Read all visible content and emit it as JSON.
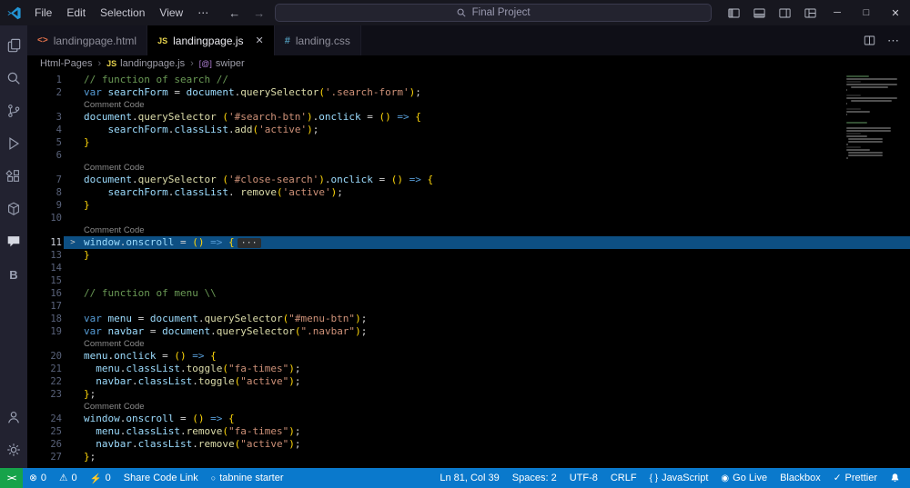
{
  "titlebar": {
    "menus": [
      "File",
      "Edit",
      "Selection",
      "View"
    ],
    "overflow": "⋯",
    "nav_back": "←",
    "nav_forward": "→",
    "search": {
      "value": "Final Project"
    },
    "window_icons": [
      "layout-sidebar-left-icon",
      "layout-panel-icon",
      "layout-sidebar-right-icon",
      "layout-customize-icon"
    ],
    "window_controls": {
      "minimize": "─",
      "maximize": "□",
      "close": "✕"
    }
  },
  "activity_bar": {
    "top": [
      "explorer-icon",
      "search-icon",
      "source-control-icon",
      "run-debug-icon",
      "extensions-icon",
      "package-icon",
      "comments-icon",
      "blackbox-b-icon"
    ],
    "bottom": [
      "account-icon",
      "settings-gear-icon"
    ]
  },
  "tabs": {
    "items": [
      {
        "icon": "html-icon",
        "label": "landingpage.html",
        "active": false
      },
      {
        "icon": "js-icon",
        "label": "landingpage.js",
        "active": true,
        "close": "✕"
      },
      {
        "icon": "css-icon",
        "label": "landing.css",
        "active": false
      }
    ],
    "actions": [
      "split-editor-icon",
      "more-actions-icon"
    ]
  },
  "breadcrumbs": {
    "separator": "›",
    "items": [
      {
        "label": "Html-Pages"
      },
      {
        "label": "landingpage.js",
        "icon": "js-icon"
      },
      {
        "label": "swiper",
        "icon": "symbol-icon"
      }
    ]
  },
  "editor": {
    "fold_marker": ">",
    "rows": [
      {
        "n": "1",
        "seg": [
          [
            "cm",
            "// function of search //"
          ]
        ]
      },
      {
        "n": "2",
        "seg": [
          [
            "kw",
            "var"
          ],
          [
            "pn",
            " "
          ],
          [
            "vr",
            "searchForm"
          ],
          [
            "pn",
            " "
          ],
          [
            "op",
            "="
          ],
          [
            "pn",
            " "
          ],
          [
            "vr",
            "document"
          ],
          [
            "pn",
            "."
          ],
          [
            "fn",
            "querySelector"
          ],
          [
            "br",
            "("
          ],
          [
            "st",
            "'.search-form'"
          ],
          [
            "br",
            ")"
          ],
          [
            "pn",
            ";"
          ]
        ]
      },
      {
        "lens": "Comment Code"
      },
      {
        "n": "3",
        "seg": [
          [
            "vr",
            "document"
          ],
          [
            "pn",
            "."
          ],
          [
            "fn",
            "querySelector"
          ],
          [
            "pn",
            " "
          ],
          [
            "br",
            "("
          ],
          [
            "st",
            "'#search-btn'"
          ],
          [
            "br",
            ")"
          ],
          [
            "pn",
            "."
          ],
          [
            "vr",
            "onclick"
          ],
          [
            "pn",
            " "
          ],
          [
            "op",
            "="
          ],
          [
            "pn",
            " "
          ],
          [
            "br",
            "()"
          ],
          [
            "pn",
            " "
          ],
          [
            "kw",
            "=>"
          ],
          [
            "pn",
            " "
          ],
          [
            "br",
            "{"
          ]
        ]
      },
      {
        "n": "4",
        "seg": [
          [
            "pn",
            "    "
          ],
          [
            "vr",
            "searchForm"
          ],
          [
            "pn",
            "."
          ],
          [
            "vr",
            "classList"
          ],
          [
            "pn",
            "."
          ],
          [
            "fn",
            "add"
          ],
          [
            "br",
            "("
          ],
          [
            "st",
            "'active'"
          ],
          [
            "br",
            ")"
          ],
          [
            "pn",
            ";"
          ]
        ]
      },
      {
        "n": "5",
        "seg": [
          [
            "br",
            "}"
          ]
        ]
      },
      {
        "n": "6",
        "seg": []
      },
      {
        "lens": "Comment Code"
      },
      {
        "n": "7",
        "seg": [
          [
            "vr",
            "document"
          ],
          [
            "pn",
            "."
          ],
          [
            "fn",
            "querySelector"
          ],
          [
            "pn",
            " "
          ],
          [
            "br",
            "("
          ],
          [
            "st",
            "'#close-search'"
          ],
          [
            "br",
            ")"
          ],
          [
            "pn",
            "."
          ],
          [
            "vr",
            "onclick"
          ],
          [
            "pn",
            " "
          ],
          [
            "op",
            "="
          ],
          [
            "pn",
            " "
          ],
          [
            "br",
            "()"
          ],
          [
            "pn",
            " "
          ],
          [
            "kw",
            "=>"
          ],
          [
            "pn",
            " "
          ],
          [
            "br",
            "{"
          ]
        ]
      },
      {
        "n": "8",
        "seg": [
          [
            "pn",
            "    "
          ],
          [
            "vr",
            "searchForm"
          ],
          [
            "pn",
            "."
          ],
          [
            "vr",
            "classList"
          ],
          [
            "pn",
            ". "
          ],
          [
            "fn",
            "remove"
          ],
          [
            "br",
            "("
          ],
          [
            "st",
            "'active'"
          ],
          [
            "br",
            ")"
          ],
          [
            "pn",
            ";"
          ]
        ]
      },
      {
        "n": "9",
        "seg": [
          [
            "br",
            "}"
          ]
        ]
      },
      {
        "n": "10",
        "seg": []
      },
      {
        "lens": "Comment Code"
      },
      {
        "n": "11",
        "hl": true,
        "fold": true,
        "ellipsis": "···",
        "seg": [
          [
            "vr",
            "window"
          ],
          [
            "pn",
            "."
          ],
          [
            "vr",
            "onscroll"
          ],
          [
            "pn",
            " "
          ],
          [
            "op",
            "="
          ],
          [
            "pn",
            " "
          ],
          [
            "br",
            "()"
          ],
          [
            "pn",
            " "
          ],
          [
            "kw",
            "=>"
          ],
          [
            "pn",
            " "
          ],
          [
            "br",
            "{"
          ]
        ]
      },
      {
        "n": "13",
        "seg": [
          [
            "br",
            "}"
          ]
        ]
      },
      {
        "n": "14",
        "seg": []
      },
      {
        "n": "15",
        "seg": []
      },
      {
        "n": "16",
        "seg": [
          [
            "cm",
            "// function of menu \\\\"
          ]
        ]
      },
      {
        "n": "17",
        "seg": []
      },
      {
        "n": "18",
        "seg": [
          [
            "kw",
            "var"
          ],
          [
            "pn",
            " "
          ],
          [
            "vr",
            "menu"
          ],
          [
            "pn",
            " "
          ],
          [
            "op",
            "="
          ],
          [
            "pn",
            " "
          ],
          [
            "vr",
            "document"
          ],
          [
            "pn",
            "."
          ],
          [
            "fn",
            "querySelector"
          ],
          [
            "br",
            "("
          ],
          [
            "st",
            "\"#menu-btn\""
          ],
          [
            "br",
            ")"
          ],
          [
            "pn",
            ";"
          ]
        ]
      },
      {
        "n": "19",
        "seg": [
          [
            "kw",
            "var"
          ],
          [
            "pn",
            " "
          ],
          [
            "vr",
            "navbar"
          ],
          [
            "pn",
            " "
          ],
          [
            "op",
            "="
          ],
          [
            "pn",
            " "
          ],
          [
            "vr",
            "document"
          ],
          [
            "pn",
            "."
          ],
          [
            "fn",
            "querySelector"
          ],
          [
            "br",
            "("
          ],
          [
            "st",
            "\".navbar\""
          ],
          [
            "br",
            ")"
          ],
          [
            "pn",
            ";"
          ]
        ]
      },
      {
        "lens": "Comment Code"
      },
      {
        "n": "20",
        "seg": [
          [
            "vr",
            "menu"
          ],
          [
            "pn",
            "."
          ],
          [
            "vr",
            "onclick"
          ],
          [
            "pn",
            " "
          ],
          [
            "op",
            "="
          ],
          [
            "pn",
            " "
          ],
          [
            "br",
            "()"
          ],
          [
            "pn",
            " "
          ],
          [
            "kw",
            "=>"
          ],
          [
            "pn",
            " "
          ],
          [
            "br",
            "{"
          ]
        ]
      },
      {
        "n": "21",
        "seg": [
          [
            "pn",
            "  "
          ],
          [
            "vr",
            "menu"
          ],
          [
            "pn",
            "."
          ],
          [
            "vr",
            "classList"
          ],
          [
            "pn",
            "."
          ],
          [
            "fn",
            "toggle"
          ],
          [
            "br",
            "("
          ],
          [
            "st",
            "\"fa-times\""
          ],
          [
            "br",
            ")"
          ],
          [
            "pn",
            ";"
          ]
        ]
      },
      {
        "n": "22",
        "seg": [
          [
            "pn",
            "  "
          ],
          [
            "vr",
            "navbar"
          ],
          [
            "pn",
            "."
          ],
          [
            "vr",
            "classList"
          ],
          [
            "pn",
            "."
          ],
          [
            "fn",
            "toggle"
          ],
          [
            "br",
            "("
          ],
          [
            "st",
            "\"active\""
          ],
          [
            "br",
            ")"
          ],
          [
            "pn",
            ";"
          ]
        ]
      },
      {
        "n": "23",
        "seg": [
          [
            "br",
            "}"
          ],
          [
            "pn",
            ";"
          ]
        ]
      },
      {
        "lens": "Comment Code"
      },
      {
        "n": "24",
        "seg": [
          [
            "vr",
            "window"
          ],
          [
            "pn",
            "."
          ],
          [
            "vr",
            "onscroll"
          ],
          [
            "pn",
            " "
          ],
          [
            "op",
            "="
          ],
          [
            "pn",
            " "
          ],
          [
            "br",
            "()"
          ],
          [
            "pn",
            " "
          ],
          [
            "kw",
            "=>"
          ],
          [
            "pn",
            " "
          ],
          [
            "br",
            "{"
          ]
        ]
      },
      {
        "n": "25",
        "seg": [
          [
            "pn",
            "  "
          ],
          [
            "vr",
            "menu"
          ],
          [
            "pn",
            "."
          ],
          [
            "vr",
            "classList"
          ],
          [
            "pn",
            "."
          ],
          [
            "fn",
            "remove"
          ],
          [
            "br",
            "("
          ],
          [
            "st",
            "\"fa-times\""
          ],
          [
            "br",
            ")"
          ],
          [
            "pn",
            ";"
          ]
        ]
      },
      {
        "n": "26",
        "seg": [
          [
            "pn",
            "  "
          ],
          [
            "vr",
            "navbar"
          ],
          [
            "pn",
            "."
          ],
          [
            "vr",
            "classList"
          ],
          [
            "pn",
            "."
          ],
          [
            "fn",
            "remove"
          ],
          [
            "br",
            "("
          ],
          [
            "st",
            "\"active\""
          ],
          [
            "br",
            ")"
          ],
          [
            "pn",
            ";"
          ]
        ]
      },
      {
        "n": "27",
        "seg": [
          [
            "br",
            "}"
          ],
          [
            "pn",
            ";"
          ]
        ]
      }
    ]
  },
  "statusbar": {
    "remote": {
      "icon": "remote-icon",
      "bg": "#16a34a"
    },
    "left": [
      {
        "icon": "error-icon",
        "text": "0"
      },
      {
        "icon": "warning-icon",
        "text": "0"
      },
      {
        "icon": "zap-icon",
        "text": "0"
      },
      {
        "text": "Share Code Link"
      },
      {
        "icon": "tabnine-icon",
        "text": "tabnine starter"
      }
    ],
    "right": [
      {
        "text": "Ln 81, Col 39"
      },
      {
        "text": "Spaces: 2"
      },
      {
        "text": "UTF-8"
      },
      {
        "text": "CRLF"
      },
      {
        "icon": "braces-icon",
        "text": "JavaScript"
      },
      {
        "icon": "broadcast-icon",
        "text": "Go Live"
      },
      {
        "text": "Blackbox"
      },
      {
        "icon": "check-icon",
        "text": "Prettier"
      },
      {
        "icon": "bell-icon",
        "text": ""
      }
    ]
  },
  "colors": {
    "statusbar_bg": "#0a79cc",
    "remote_bg": "#16a34a",
    "highlight_line": "#0d4f83",
    "keyword": "#569cd6",
    "variable": "#9cdcfe",
    "function": "#dcdcaa",
    "string": "#ce9178",
    "comment": "#6a9955",
    "bracket": "#ffd70a"
  }
}
